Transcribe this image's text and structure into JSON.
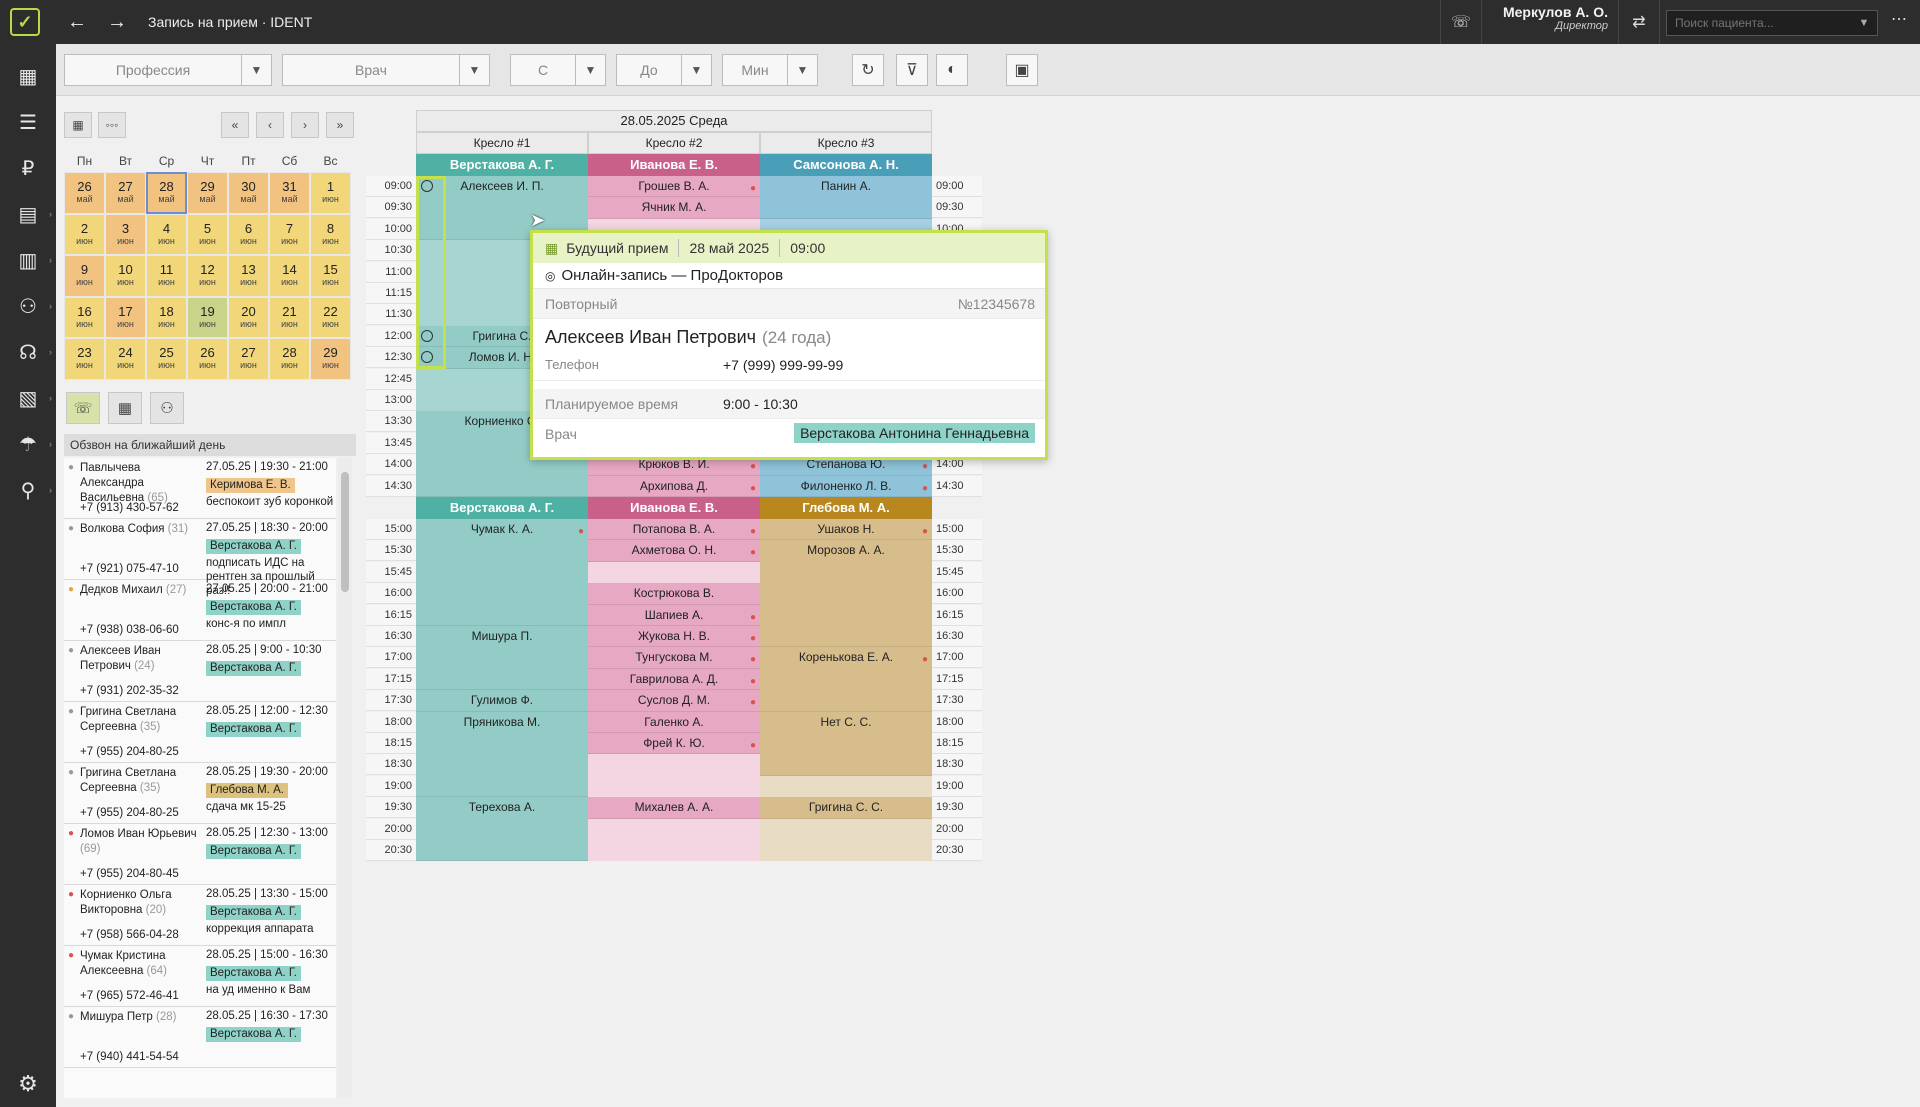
{
  "titlebar": {
    "title": "Запись на прием · IDENT",
    "user_name": "Меркулов А. О.",
    "user_role": "Директор",
    "search_placeholder": "Поиск пациента..."
  },
  "filters": {
    "profession": "Профессия",
    "doctor": "Врач",
    "from": "С",
    "to": "До",
    "min": "Мин"
  },
  "calendar": {
    "weekdays": [
      "Пн",
      "Вт",
      "Ср",
      "Чт",
      "Пт",
      "Сб",
      "Вс"
    ],
    "weeks": [
      [
        {
          "d": "26",
          "m": "май",
          "c": "o"
        },
        {
          "d": "27",
          "m": "май",
          "c": "o"
        },
        {
          "d": "28",
          "m": "май",
          "c": "o",
          "today": true
        },
        {
          "d": "29",
          "m": "май",
          "c": "o"
        },
        {
          "d": "30",
          "m": "май",
          "c": "o"
        },
        {
          "d": "31",
          "m": "май",
          "c": "o"
        },
        {
          "d": "1",
          "m": "июн",
          "c": "y"
        }
      ],
      [
        {
          "d": "2",
          "m": "июн",
          "c": "y"
        },
        {
          "d": "3",
          "m": "июн",
          "c": "o"
        },
        {
          "d": "4",
          "m": "июн",
          "c": "y"
        },
        {
          "d": "5",
          "m": "июн",
          "c": "y"
        },
        {
          "d": "6",
          "m": "июн",
          "c": "y"
        },
        {
          "d": "7",
          "m": "июн",
          "c": "y"
        },
        {
          "d": "8",
          "m": "июн",
          "c": "y"
        }
      ],
      [
        {
          "d": "9",
          "m": "июн",
          "c": "o"
        },
        {
          "d": "10",
          "m": "июн",
          "c": "y"
        },
        {
          "d": "11",
          "m": "июн",
          "c": "y"
        },
        {
          "d": "12",
          "m": "июн",
          "c": "y"
        },
        {
          "d": "13",
          "m": "июн",
          "c": "y"
        },
        {
          "d": "14",
          "m": "июн",
          "c": "y"
        },
        {
          "d": "15",
          "m": "июн",
          "c": "y"
        }
      ],
      [
        {
          "d": "16",
          "m": "июн",
          "c": "y"
        },
        {
          "d": "17",
          "m": "июн",
          "c": "o"
        },
        {
          "d": "18",
          "m": "июн",
          "c": "y"
        },
        {
          "d": "19",
          "m": "июн",
          "c": "g"
        },
        {
          "d": "20",
          "m": "июн",
          "c": "y"
        },
        {
          "d": "21",
          "m": "июн",
          "c": "y"
        },
        {
          "d": "22",
          "m": "июн",
          "c": "y"
        }
      ],
      [
        {
          "d": "23",
          "m": "июн",
          "c": "y"
        },
        {
          "d": "24",
          "m": "июн",
          "c": "y"
        },
        {
          "d": "25",
          "m": "июн",
          "c": "y"
        },
        {
          "d": "26",
          "m": "июн",
          "c": "y"
        },
        {
          "d": "27",
          "m": "июн",
          "c": "y"
        },
        {
          "d": "28",
          "m": "июн",
          "c": "y"
        },
        {
          "d": "29",
          "m": "июн",
          "c": "o"
        }
      ]
    ]
  },
  "calls": {
    "title": "Обзвон на ближайший день",
    "items": [
      {
        "name": "Павлычева Александра Васильевна",
        "age": "(65)",
        "phone": "+7 (913) 430-57-62",
        "time": "27.05.25 | 19:30 - 21:00",
        "doctor": "Керимова Е. В.",
        "dc": "orange",
        "note": "беспокоит зуб коронкой",
        "ic": "grey"
      },
      {
        "name": "Волкова София",
        "age": "(31)",
        "phone": "+7 (921) 075-47-10",
        "time": "27.05.25 | 18:30 - 20:00",
        "doctor": "Верстакова А. Г.",
        "dc": "teal",
        "note": "подписать ИДС на рентген за прошлый раз!!",
        "ic": "grey"
      },
      {
        "name": "Дедков Михаил",
        "age": "(27)",
        "phone": "+7 (938) 038-06-60",
        "time": "27.05.25 | 20:00 - 21:00",
        "doctor": "Верстакова А. Г.",
        "dc": "teal",
        "note": "конс-я по импл",
        "ic": "orange"
      },
      {
        "name": "Алексеев Иван Петрович",
        "age": "(24)",
        "phone": "+7 (931) 202-35-32",
        "time": "28.05.25 | 9:00 - 10:30",
        "doctor": "Верстакова А. Г.",
        "dc": "teal",
        "note": "",
        "ic": "grey"
      },
      {
        "name": "Григина Светлана Сергеевна",
        "age": "(35)",
        "phone": "+7 (955) 204-80-25",
        "time": "28.05.25 | 12:00 - 12:30",
        "doctor": "Верстакова А. Г.",
        "dc": "teal",
        "note": "",
        "ic": "grey"
      },
      {
        "name": "Григина Светлана Сергеевна",
        "age": "(35)",
        "phone": "+7 (955) 204-80-25",
        "time": "28.05.25 | 19:30 - 20:00",
        "doctor": "Глебова М. А.",
        "dc": "brown",
        "note": "сдача мк 15-25",
        "ic": "grey"
      },
      {
        "name": "Ломов Иван Юрьевич",
        "age": "(69)",
        "phone": "+7 (955) 204-80-45",
        "time": "28.05.25 | 12:30 - 13:00",
        "doctor": "Верстакова А. Г.",
        "dc": "teal",
        "note": "",
        "ic": "red"
      },
      {
        "name": "Корниенко Ольга Викторовна",
        "age": "(20)",
        "phone": "+7 (958) 566-04-28",
        "time": "28.05.25 | 13:30 - 15:00",
        "doctor": "Верстакова А. Г.",
        "dc": "teal",
        "note": "коррекция аппарата",
        "ic": "red"
      },
      {
        "name": "Чумак Кристина Алексеевна",
        "age": "(64)",
        "phone": "+7 (965) 572-46-41",
        "time": "28.05.25 | 15:00 - 16:30",
        "doctor": "Верстакова А. Г.",
        "dc": "teal",
        "note": "на уд именно к Вам",
        "ic": "red"
      },
      {
        "name": "Мишура Петр",
        "age": "(28)",
        "phone": "+7 (940) 441-54-54",
        "time": "28.05.25 | 16:30 - 17:30",
        "doctor": "Верстакова А. Г.",
        "dc": "teal",
        "note": "",
        "ic": "grey"
      }
    ]
  },
  "schedule": {
    "date": "28.05.2025 Среда",
    "chairs": [
      "Кресло #1",
      "Кресло #2",
      "Кресло #3"
    ],
    "doctors_am": [
      "Верстакова А. Г.",
      "Иванова Е. В.",
      "Самсонова А. Н."
    ],
    "doctors_pm": [
      "Верстакова А. Г.",
      "Иванова Е. В.",
      "Глебова М. А."
    ],
    "times_am": [
      "09:00",
      "09:30",
      "10:00",
      "10:30",
      "11:00",
      "11:15",
      "11:30",
      "12:00",
      "12:30",
      "12:45",
      "13:00",
      "13:30",
      "13:45",
      "14:00",
      "14:30"
    ],
    "times_pm": [
      "15:00",
      "15:30",
      "15:45",
      "16:00",
      "16:15",
      "16:30",
      "17:00",
      "17:15",
      "17:30",
      "18:00",
      "18:15",
      "18:30",
      "19:00",
      "19:30",
      "20:00",
      "20:30"
    ],
    "appts": [
      {
        "col": 0,
        "row": 0,
        "span": 3,
        "text": "Алексеев И. П.",
        "cls": "ap-teal"
      },
      {
        "col": 0,
        "row": 7,
        "span": 1,
        "text": "Григина С.",
        "cls": "ap-teal"
      },
      {
        "col": 0,
        "row": 8,
        "span": 1,
        "text": "Ломов И. Н.",
        "cls": "ap-teal"
      },
      {
        "col": 0,
        "row": 11,
        "span": 4,
        "text": "Корниенко О.",
        "cls": "ap-teal"
      },
      {
        "col": 1,
        "row": 0,
        "span": 1,
        "text": "Грошев В. А.",
        "cls": "ap-pink",
        "pin": true
      },
      {
        "col": 1,
        "row": 1,
        "span": 1,
        "text": "Ячник М. А.",
        "cls": "ap-pink"
      },
      {
        "col": 1,
        "row": 13,
        "span": 1,
        "text": "Крюков В. И.",
        "cls": "ap-pink",
        "pin": true
      },
      {
        "col": 1,
        "row": 14,
        "span": 1,
        "text": "Архипова Д.",
        "cls": "ap-pink",
        "pin": true
      },
      {
        "col": 2,
        "row": 0,
        "span": 2,
        "text": "Панин А.",
        "cls": "ap-blue"
      },
      {
        "col": 2,
        "row": 13,
        "span": 1,
        "text": "Степанова Ю.",
        "cls": "ap-blue",
        "pin": true
      },
      {
        "col": 2,
        "row": 14,
        "span": 1,
        "text": "Филоненко Л. В.",
        "cls": "ap-blue",
        "pin": true
      },
      {
        "col": 0,
        "row": 16,
        "span": 5,
        "text": "Чумак К. А.",
        "cls": "ap-teal",
        "pin": true
      },
      {
        "col": 0,
        "row": 21,
        "span": 3,
        "text": "Мишура П.",
        "cls": "ap-teal"
      },
      {
        "col": 0,
        "row": 24,
        "span": 1,
        "text": "Гулимов Ф.",
        "cls": "ap-teal"
      },
      {
        "col": 0,
        "row": 25,
        "span": 4,
        "text": "Пряникова М.",
        "cls": "ap-teal"
      },
      {
        "col": 0,
        "row": 29,
        "span": 3,
        "text": "Терехова А.",
        "cls": "ap-teal"
      },
      {
        "col": 1,
        "row": 16,
        "span": 1,
        "text": "Потапова В. А.",
        "cls": "ap-pink",
        "pin": true
      },
      {
        "col": 1,
        "row": 17,
        "span": 1,
        "text": "Ахметова О. Н.",
        "cls": "ap-pink",
        "pin": true
      },
      {
        "col": 1,
        "row": 19,
        "span": 1,
        "text": "Кострюкова В.",
        "cls": "ap-pink"
      },
      {
        "col": 1,
        "row": 20,
        "span": 1,
        "text": "Шапиев А.",
        "cls": "ap-pink",
        "pin": true
      },
      {
        "col": 1,
        "row": 21,
        "span": 1,
        "text": "Жукова Н. В.",
        "cls": "ap-pink",
        "pin": true
      },
      {
        "col": 1,
        "row": 22,
        "span": 1,
        "text": "Тунгускова М.",
        "cls": "ap-pink",
        "pin": true
      },
      {
        "col": 1,
        "row": 23,
        "span": 1,
        "text": "Гаврилова А. Д.",
        "cls": "ap-pink",
        "pin": true
      },
      {
        "col": 1,
        "row": 24,
        "span": 1,
        "text": "Суслов Д. М.",
        "cls": "ap-pink",
        "pin": true
      },
      {
        "col": 1,
        "row": 25,
        "span": 1,
        "text": "Галенко А.",
        "cls": "ap-pink"
      },
      {
        "col": 1,
        "row": 26,
        "span": 1,
        "text": "Фрей К. Ю.",
        "cls": "ap-pink",
        "pin": true
      },
      {
        "col": 1,
        "row": 29,
        "span": 1,
        "text": "Михалев А. А.",
        "cls": "ap-pink"
      },
      {
        "col": 2,
        "row": 16,
        "span": 1,
        "text": "Ушаков Н.",
        "cls": "ap-tan",
        "pin": true
      },
      {
        "col": 2,
        "row": 17,
        "span": 5,
        "text": "Морозов А. А.",
        "cls": "ap-tan"
      },
      {
        "col": 2,
        "row": 22,
        "span": 3,
        "text": "Коренькова Е. А.",
        "cls": "ap-tan",
        "pin": true
      },
      {
        "col": 2,
        "row": 25,
        "span": 3,
        "text": "Нет С. С.",
        "cls": "ap-tan"
      },
      {
        "col": 2,
        "row": 29,
        "span": 1,
        "text": "Григина С. С.",
        "cls": "ap-tan"
      }
    ]
  },
  "popup": {
    "status": "Будущий прием",
    "date": "28 май 2025",
    "time": "09:00",
    "source": "Онлайн-запись — ПроДокторов",
    "visit_type": "Повторный",
    "number": "№12345678",
    "patient": "Алексеев Иван Петрович",
    "age": "(24 года)",
    "phone_label": "Телефон",
    "phone": "+7 (999) 999-99-99",
    "planned_label": "Планируемое время",
    "planned": "9:00 - 10:30",
    "doctor_label": "Врач",
    "doctor": "Верстакова Антонина Геннадьевна"
  }
}
